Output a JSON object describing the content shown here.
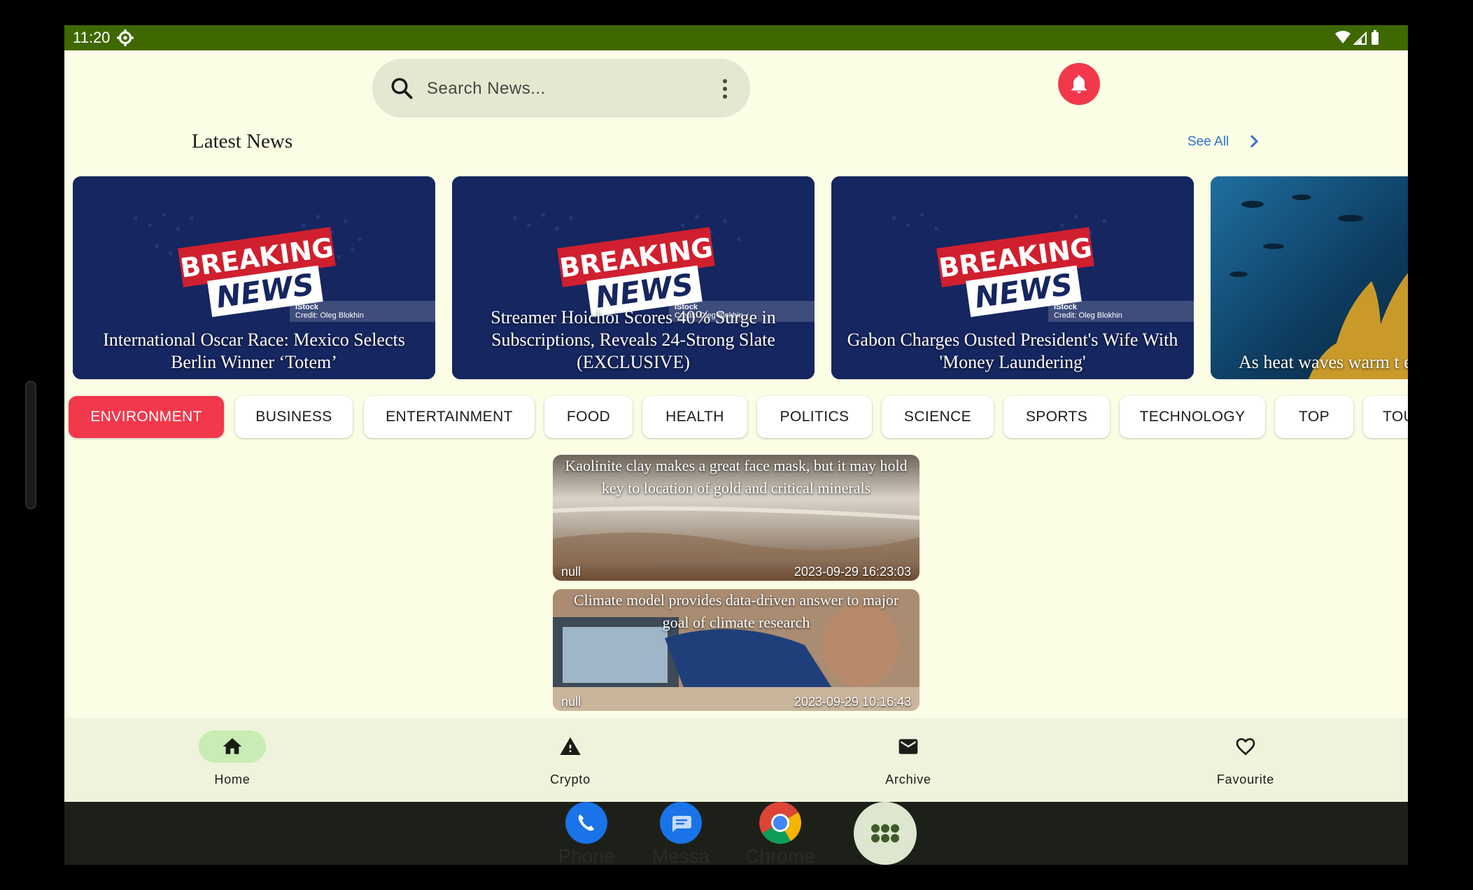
{
  "status_bar": {
    "time": "11:20"
  },
  "search": {
    "placeholder": "Search News..."
  },
  "latest": {
    "title": "Latest News",
    "see_all": "See All"
  },
  "latest_cards": [
    {
      "title": "International Oscar Race: Mexico Selects Berlin Winner ‘Totem’",
      "image_text": [
        "BREAKING",
        "NEWS"
      ],
      "credit": [
        "iStock",
        "Credit: Oleg Blokhin"
      ]
    },
    {
      "title": "Streamer Hoichoi Scores 40% Surge in Subscriptions, Reveals 24-Strong Slate (EXCLUSIVE)",
      "image_text": [
        "BREAKING",
        "NEWS"
      ],
      "credit": [
        "iStock",
        "Credit: Oleg Blokhin"
      ]
    },
    {
      "title": "Gabon Charges Ousted President's Wife With 'Money Laundering'",
      "image_text": [
        "BREAKING",
        "NEWS"
      ],
      "credit": [
        "iStock",
        "Credit: Oleg Blokhin"
      ]
    },
    {
      "title": "As heat waves warm t effects on marine lif"
    }
  ],
  "categories": [
    "ENVIRONMENT",
    "BUSINESS",
    "ENTERTAINMENT",
    "FOOD",
    "HEALTH",
    "POLITICS",
    "SCIENCE",
    "SPORTS",
    "TECHNOLOGY",
    "TOP",
    "TOU"
  ],
  "selected_category": "ENVIRONMENT",
  "news": [
    {
      "title": "Kaolinite clay makes a great face mask, but it may hold key to location of gold and critical minerals",
      "source": "null",
      "date": "2023-09-29 16:23:03"
    },
    {
      "title": "Climate model provides data-driven answer to major goal of climate research",
      "source": "null",
      "date": "2023-09-29 10:16:43"
    }
  ],
  "bottom_nav": [
    {
      "label": "Home",
      "icon": "home-icon",
      "active": true
    },
    {
      "label": "Crypto",
      "icon": "warning-icon",
      "active": false
    },
    {
      "label": "Archive",
      "icon": "mail-icon",
      "active": false
    },
    {
      "label": "Favourite",
      "icon": "heart-icon",
      "active": false
    }
  ],
  "dock": [
    {
      "label": "Phone",
      "icon": "phone-icon"
    },
    {
      "label": "Messa",
      "icon": "messages-icon"
    },
    {
      "label": "Chrome",
      "icon": "chrome-icon"
    }
  ],
  "colors": {
    "accent": "#f2384a",
    "status_bar": "#406800",
    "background": "#fbfde5",
    "nav_active": "#c8ecb3",
    "link": "#2f6fd6"
  }
}
